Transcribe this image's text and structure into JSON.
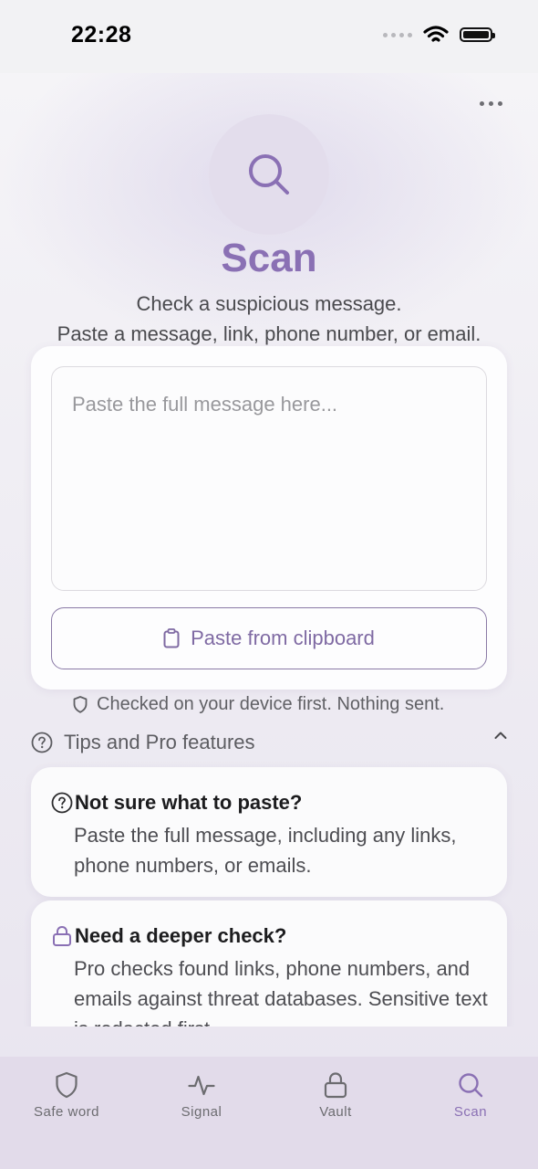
{
  "status_bar": {
    "time": "22:28"
  },
  "header": {
    "title": "Scan",
    "subtitle_line1": "Check a suspicious message.",
    "subtitle_line2": "Paste a message, link, phone number, or email."
  },
  "scan_card": {
    "input_value": "",
    "input_placeholder": "Paste the full message here...",
    "paste_button_label": "Paste from clipboard"
  },
  "privacy_note": "Checked on your device first. Nothing sent.",
  "tips": {
    "header_label": "Tips and Pro features",
    "expanded": true,
    "items": [
      {
        "icon": "question-circle-icon",
        "title": "Not sure what to paste?",
        "body": "Paste the full message, including any links, phone numbers, or emails."
      },
      {
        "icon": "lock-icon",
        "title": "Need a deeper check?",
        "body": "Pro checks found links, phone numbers, and emails against threat databases. Sensitive text is redacted first."
      }
    ]
  },
  "tab_bar": {
    "items": [
      {
        "label": "Safe word",
        "icon": "shield-icon",
        "active": false
      },
      {
        "label": "Signal",
        "icon": "pulse-icon",
        "active": false
      },
      {
        "label": "Vault",
        "icon": "lock-icon",
        "active": false
      },
      {
        "label": "Scan",
        "icon": "search-icon",
        "active": true
      }
    ]
  },
  "colors": {
    "accent": "#8a70b4",
    "tab_bar_background": "#e2dbea",
    "hero_circle": "#e3ddec"
  }
}
